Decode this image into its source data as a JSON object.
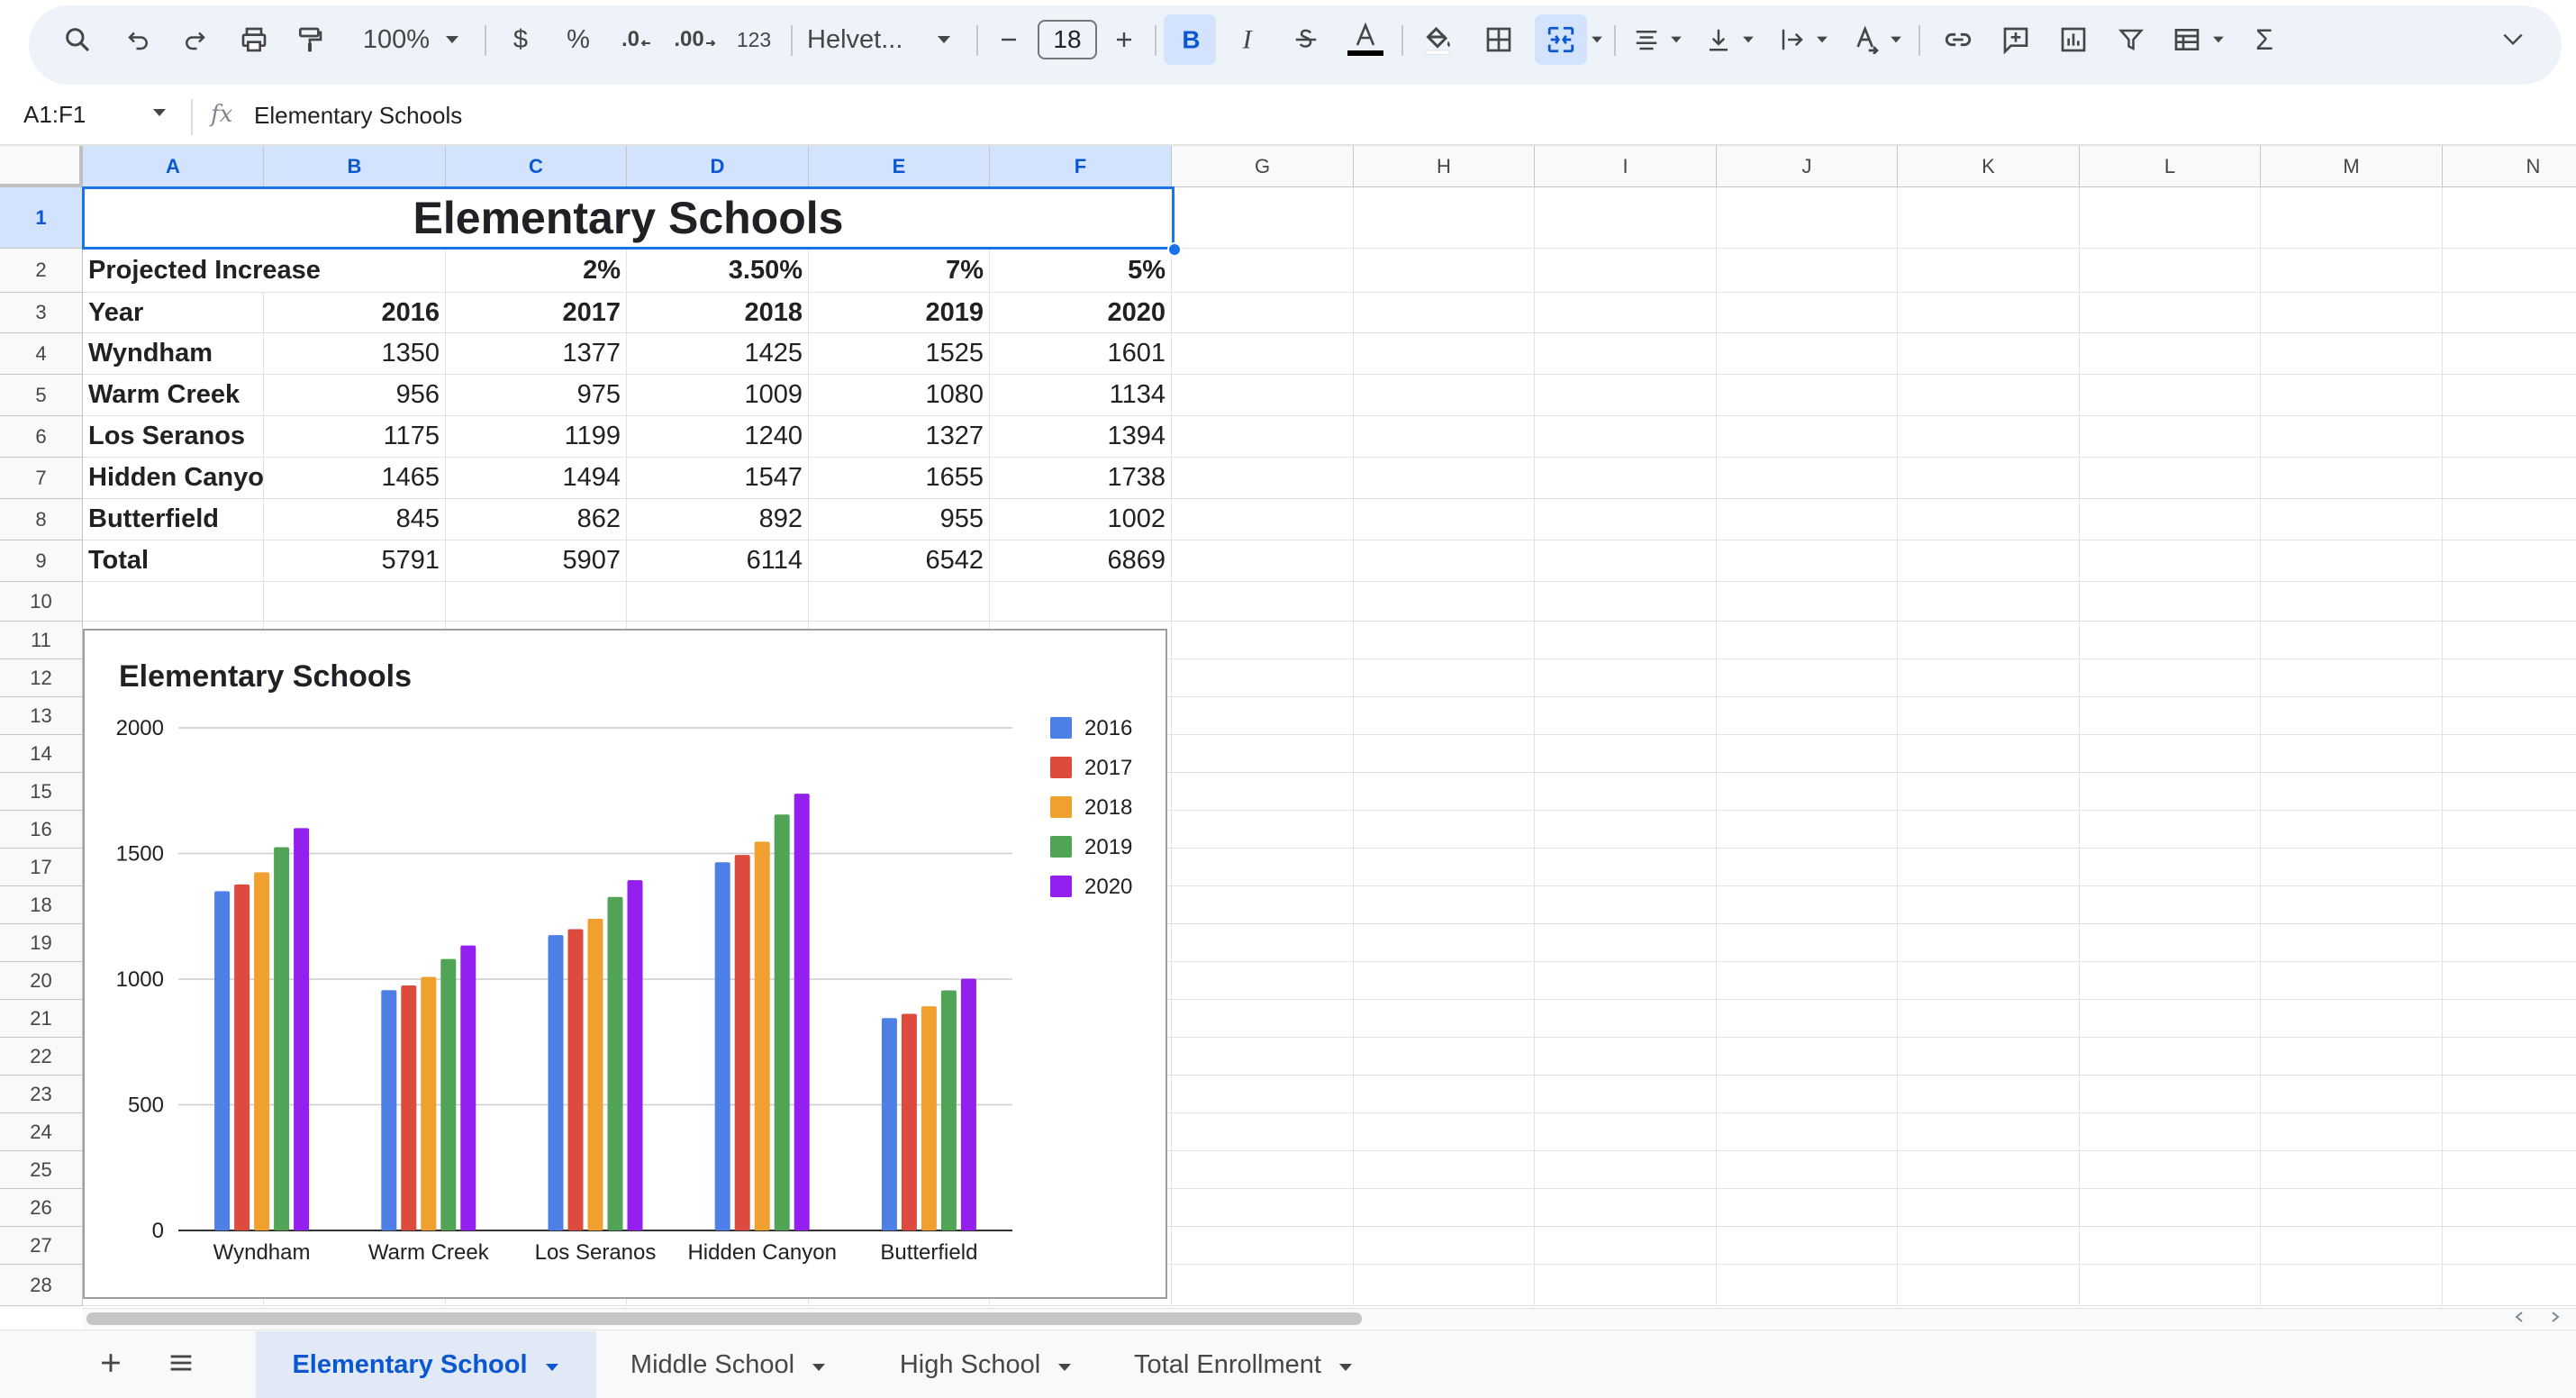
{
  "toolbar": {
    "zoom": "100%",
    "currency": "$",
    "percent": "%",
    "dec_decrease": ".0",
    "dec_increase": ".00",
    "number_format": "123",
    "font": "Helvet...",
    "font_size": "18",
    "sigma": "Σ"
  },
  "formula_bar": {
    "name_box": "A1:F1",
    "fx": "fx",
    "value": "Elementary Schools"
  },
  "columns": [
    "A",
    "B",
    "C",
    "D",
    "E",
    "F",
    "G",
    "H",
    "I",
    "J",
    "K",
    "L",
    "M",
    "N"
  ],
  "rows": [
    "1",
    "2",
    "3",
    "4",
    "5",
    "6",
    "7",
    "8",
    "9",
    "10",
    "11",
    "12",
    "13",
    "14",
    "15",
    "16",
    "17",
    "18",
    "19",
    "20",
    "21",
    "22",
    "23",
    "24",
    "25",
    "26",
    "27",
    "28"
  ],
  "sheet": {
    "title": "Elementary Schools",
    "projected_label": "Projected Increase",
    "projected": [
      "2%",
      "3.50%",
      "7%",
      "5%"
    ],
    "year_label": "Year",
    "years": [
      "2016",
      "2017",
      "2018",
      "2019",
      "2020"
    ],
    "schools": [
      {
        "name": "Wyndham",
        "values": [
          "1350",
          "1377",
          "1425",
          "1525",
          "1601"
        ]
      },
      {
        "name": "Warm Creek",
        "values": [
          "956",
          "975",
          "1009",
          "1080",
          "1134"
        ]
      },
      {
        "name": "Los Seranos",
        "values": [
          "1175",
          "1199",
          "1240",
          "1327",
          "1394"
        ]
      },
      {
        "name": "Hidden Canyo",
        "values": [
          "1465",
          "1494",
          "1547",
          "1655",
          "1738"
        ]
      },
      {
        "name": "Butterfield",
        "values": [
          "845",
          "862",
          "892",
          "955",
          "1002"
        ]
      }
    ],
    "total_label": "Total",
    "totals": [
      "5791",
      "5907",
      "6114",
      "6542",
      "6869"
    ]
  },
  "chart_data": {
    "type": "bar",
    "title": "Elementary Schools",
    "categories": [
      "Wyndham",
      "Warm Creek",
      "Los Seranos",
      "Hidden Canyon",
      "Butterfield"
    ],
    "series": [
      {
        "name": "2016",
        "values": [
          1350,
          956,
          1175,
          1465,
          845
        ],
        "color": "#4e7fe6"
      },
      {
        "name": "2017",
        "values": [
          1377,
          975,
          1199,
          1494,
          862
        ],
        "color": "#dc4b3d"
      },
      {
        "name": "2018",
        "values": [
          1425,
          1009,
          1240,
          1547,
          892
        ],
        "color": "#f0a02f"
      },
      {
        "name": "2019",
        "values": [
          1525,
          1080,
          1327,
          1655,
          955
        ],
        "color": "#51a456"
      },
      {
        "name": "2020",
        "values": [
          1601,
          1134,
          1394,
          1738,
          1002
        ],
        "color": "#9420f0"
      }
    ],
    "yticks": [
      "0",
      "500",
      "1000",
      "1500",
      "2000"
    ],
    "ylim": [
      0,
      2000
    ],
    "legend": "right",
    "grid": true
  },
  "sheet_tabs": [
    {
      "label": "Elementary School",
      "active": true
    },
    {
      "label": "Middle School",
      "active": false
    },
    {
      "label": "High School",
      "active": false
    },
    {
      "label": "Total Enrollment",
      "active": false
    }
  ],
  "colors": {
    "accent": "#0b57d0",
    "selection": "#1a73e8",
    "selected_header": "#d3e3fd"
  }
}
